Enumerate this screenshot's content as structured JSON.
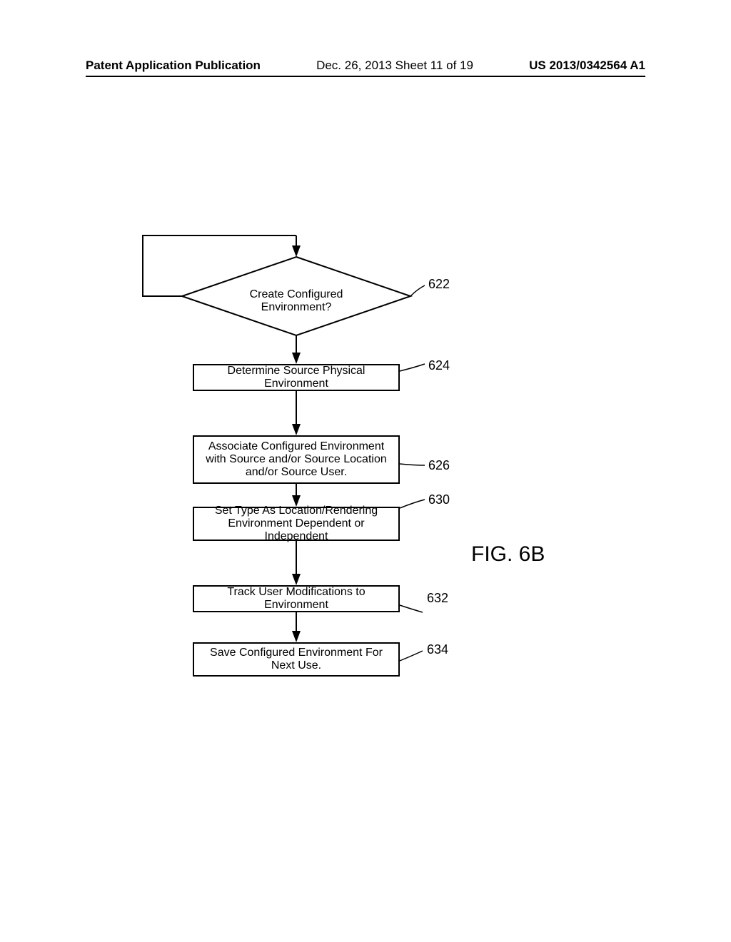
{
  "header": {
    "left": "Patent Application Publication",
    "center": "Dec. 26, 2013  Sheet 11 of 19",
    "right": "US 2013/0342564 A1"
  },
  "diagram": {
    "decision": {
      "text": "Create Configured Environment?",
      "ref": "622"
    },
    "steps": [
      {
        "text": "Determine Source Physical Environment",
        "ref": "624"
      },
      {
        "text": "Associate Configured Environment with Source and/or Source Location and/or Source User.",
        "ref": "626"
      },
      {
        "text": "Set Type As Location/Rendering Environment Dependent or Independent",
        "ref": "630"
      },
      {
        "text": "Track User Modifications to Environment",
        "ref": "632"
      },
      {
        "text": "Save Configured Environment For Next Use.",
        "ref": "634"
      }
    ],
    "figure_label": "FIG. 6B"
  }
}
